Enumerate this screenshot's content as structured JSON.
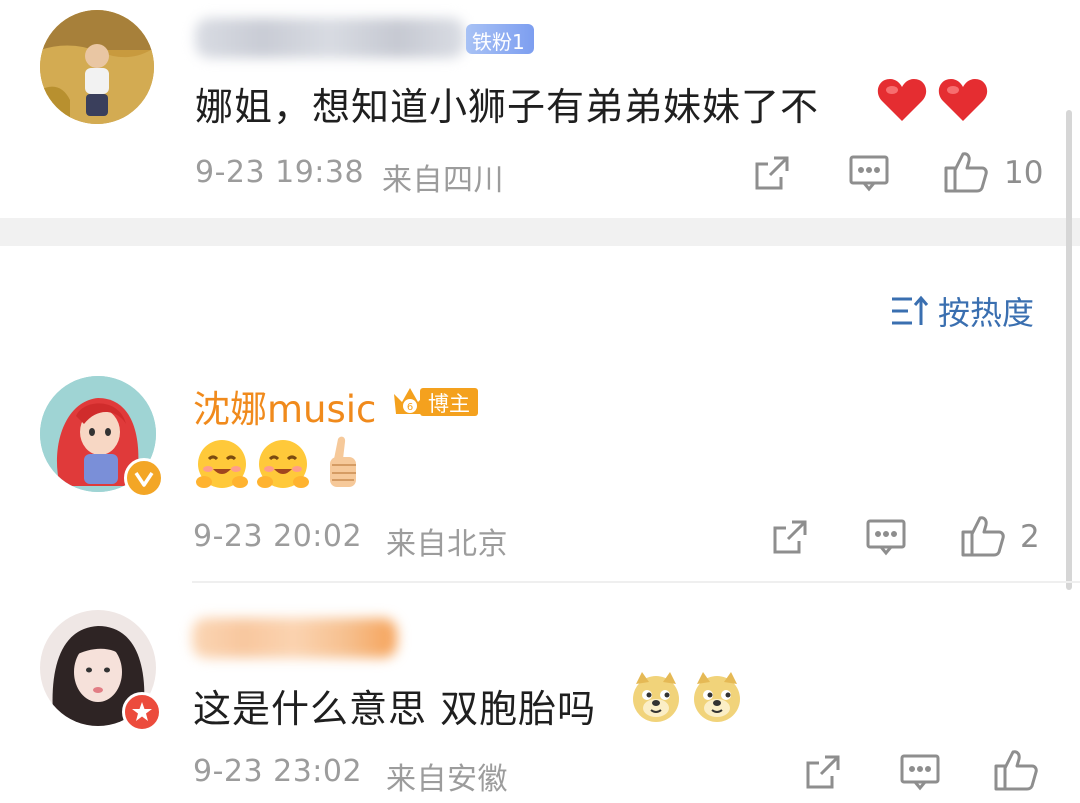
{
  "comments": [
    {
      "badge": "铁粉1",
      "text": "娜姐，想知道小狮子有弟弟妹妹了不",
      "emojis": [
        "❤",
        "❤"
      ],
      "time": "9-23 19:38",
      "location": "来自四川",
      "likes": "10"
    },
    {
      "name": "沈娜music",
      "badge": "博主",
      "emojis": [
        "😊",
        "😊",
        "👍"
      ],
      "time": "9-23 20:02",
      "location": "来自北京",
      "likes": "2"
    },
    {
      "text": "这是什么意思 双胞胎吗",
      "emojis": [
        "🐶",
        "🐶"
      ],
      "time": "9-23 23:02",
      "location": "来自安徽",
      "likes": ""
    }
  ],
  "sort": {
    "label": "按热度"
  },
  "colors": {
    "accent": "#f08a1c",
    "link_blue": "#3a6fb0",
    "meta": "#9c9c9c"
  },
  "icons": [
    "share-icon",
    "comment-icon",
    "like-icon",
    "sort-icon",
    "verified-icon",
    "crown-icon"
  ]
}
